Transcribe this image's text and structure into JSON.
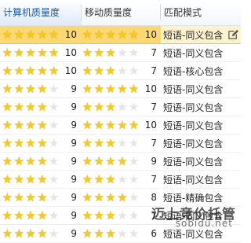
{
  "columns": {
    "pc_quality": "计算机质量度",
    "mobile_quality": "移动质量度",
    "match_mode": "匹配模式"
  },
  "rows": [
    {
      "pc_stars": 5,
      "pc_score": "10",
      "mobile_stars": 5,
      "mobile_score": "10",
      "match": "短语-同义包含",
      "selected": true
    },
    {
      "pc_stars": 5,
      "pc_score": "10",
      "mobile_stars": 3,
      "mobile_score": "7",
      "match": "短语-同义包含",
      "selected": false
    },
    {
      "pc_stars": 5,
      "pc_score": "10",
      "mobile_stars": 3,
      "mobile_score": "7",
      "match": "短语-核心包含",
      "selected": false
    },
    {
      "pc_stars": 4,
      "pc_score": "9",
      "mobile_stars": 5,
      "mobile_score": "10",
      "match": "短语-同义包含",
      "selected": false
    },
    {
      "pc_stars": 4,
      "pc_score": "9",
      "mobile_stars": 3,
      "mobile_score": "7",
      "match": "短语-同义包含",
      "selected": false
    },
    {
      "pc_stars": 4,
      "pc_score": "9",
      "mobile_stars": 5,
      "mobile_score": "10",
      "match": "短语-同义包含",
      "selected": false
    },
    {
      "pc_stars": 4,
      "pc_score": "9",
      "mobile_stars": 3,
      "mobile_score": "7",
      "match": "短语-同义包含",
      "selected": false
    },
    {
      "pc_stars": 4,
      "pc_score": "9",
      "mobile_stars": 4,
      "mobile_score": "9",
      "match": "短语-同义包含",
      "selected": false
    },
    {
      "pc_stars": 4,
      "pc_score": "9",
      "mobile_stars": 3,
      "mobile_score": "7",
      "match": "短语-同义包含",
      "selected": false
    },
    {
      "pc_stars": 4,
      "pc_score": "9",
      "mobile_stars": 4,
      "mobile_score": "8",
      "match": "短语-精确包含",
      "selected": false
    },
    {
      "pc_stars": 4,
      "pc_score": "9",
      "mobile_stars": 3,
      "mobile_score": "7",
      "match": "短语-同义包含",
      "selected": false
    },
    {
      "pc_stars": 4,
      "pc_score": "9",
      "mobile_stars": 3,
      "mobile_score": "6",
      "match": "短语-同义包含",
      "selected": false
    }
  ],
  "stars_max": 5,
  "icons": {
    "star_filled": "★",
    "star_empty": "★",
    "edit": "edit-pencil-icon"
  },
  "colors": {
    "selected_row": "#fbd873",
    "star_filled": "#f5c91f",
    "star_empty": "#e4e4e4",
    "header_sorted_text": "#1e5aa8"
  },
  "watermark": {
    "cn": "迈上竞价托管",
    "url": "sobidu.net"
  }
}
